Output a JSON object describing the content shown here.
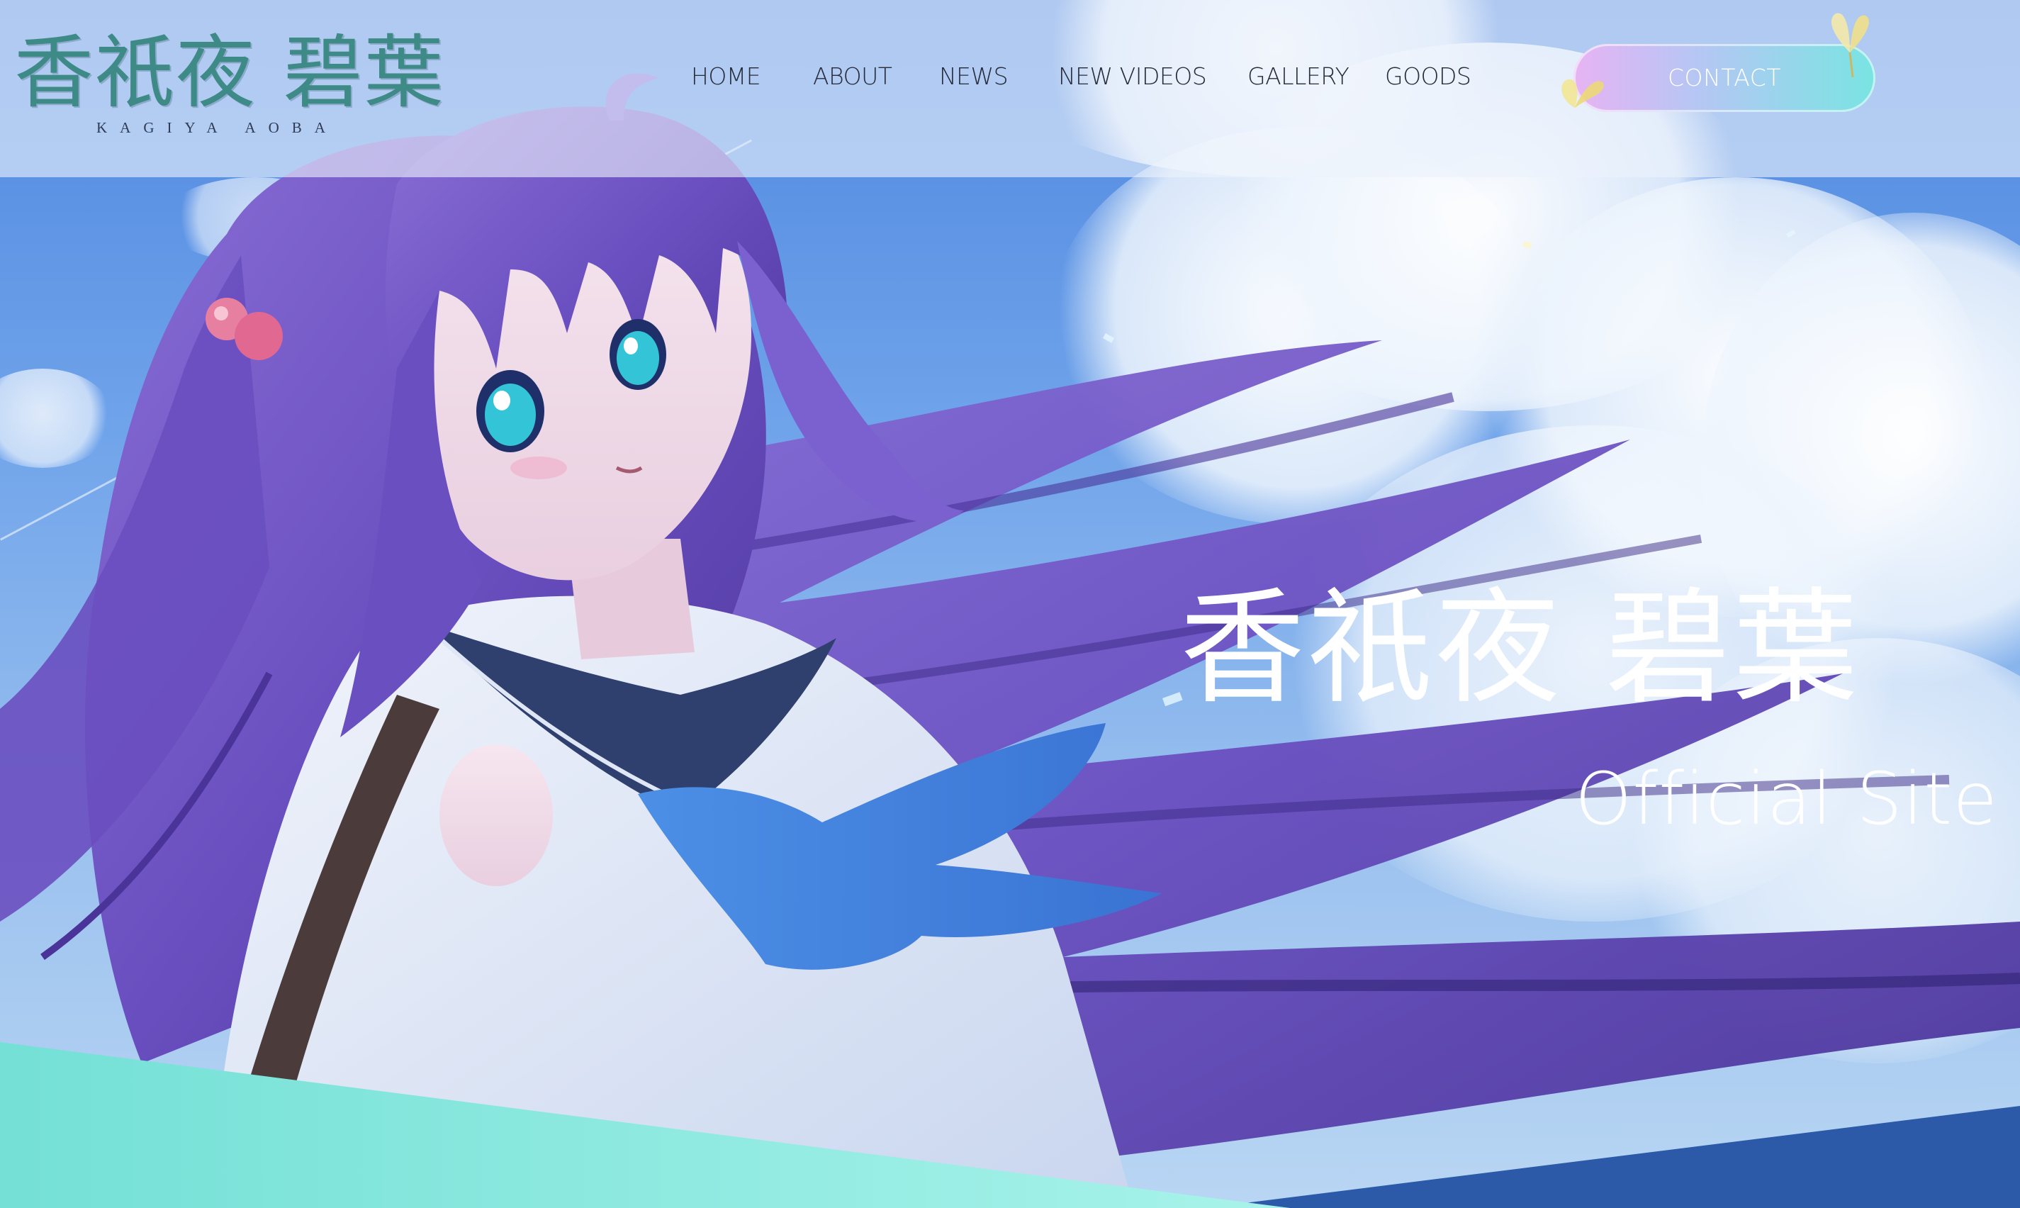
{
  "logo": {
    "kanji": "香祇夜 碧葉",
    "romaji": "KAGIYA AOBA"
  },
  "nav": {
    "items": [
      {
        "label": "HOME"
      },
      {
        "label": "ABOUT"
      },
      {
        "label": "NEWS"
      },
      {
        "label": "NEW VIDEOS"
      },
      {
        "label": "GALLERY"
      },
      {
        "label": "GOODS"
      }
    ],
    "contact_label": "CONTACT"
  },
  "hero": {
    "title": "香祇夜 碧葉",
    "subtitle": "Official Site"
  },
  "colors": {
    "sky_top": "#4d86df",
    "sky_bottom": "#b9d6f3",
    "hair": "#6a4fc0",
    "accent_teal": "#79e4e2",
    "contact_gradient_start": "#e7b3f3",
    "contact_gradient_end": "#79e4e2",
    "nav_text": "#262b3a",
    "logo_teal": "#3e8a86"
  },
  "icons": {
    "butterflies": [
      "yellow-butterfly-icon",
      "yellow-butterfly-icon"
    ]
  }
}
